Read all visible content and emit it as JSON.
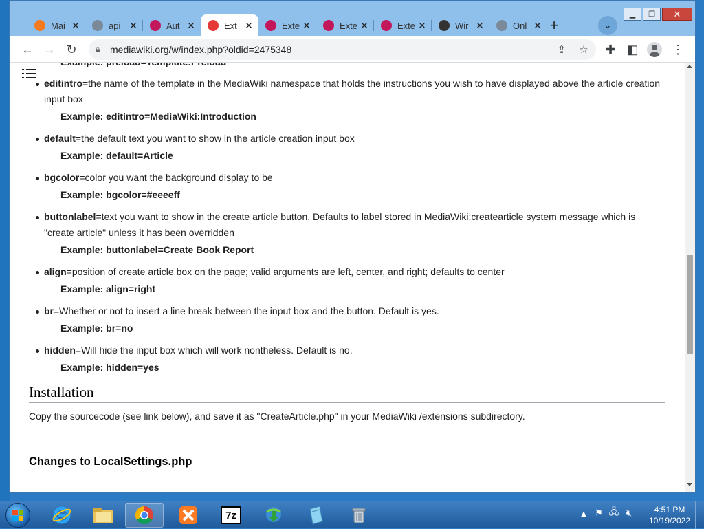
{
  "window": {
    "tabs": [
      {
        "label": "Mai",
        "icon": "xampp-icon",
        "color": "#f47a20"
      },
      {
        "label": "api",
        "icon": "globe-icon",
        "color": "#7a8a99"
      },
      {
        "label": "Aut",
        "icon": "mediawiki-icon",
        "color": "#c2185b"
      },
      {
        "label": "Ext",
        "icon": "mediawiki-icon",
        "color": "#e53935",
        "active": true
      },
      {
        "label": "Exte",
        "icon": "mediawiki-icon",
        "color": "#c2185b"
      },
      {
        "label": "Exte",
        "icon": "mediawiki-icon",
        "color": "#c2185b"
      },
      {
        "label": "Exte",
        "icon": "mediawiki-icon",
        "color": "#c2185b"
      },
      {
        "label": "Wir",
        "icon": "museum-icon",
        "color": "#333333"
      },
      {
        "label": "Onl",
        "icon": "globe-icon",
        "color": "#7a8a99"
      }
    ],
    "close_glyph": "✕",
    "new_tab_glyph": "+",
    "tab_menu_glyph": "⌄"
  },
  "toolbar": {
    "url": "mediawiki.org/w/index.php?oldid=2475348"
  },
  "page": {
    "params": [
      {
        "name": "",
        "desc": "",
        "example": "Example: preload=Template:Preload"
      },
      {
        "name": "editintro",
        "desc": "=the name of the template in the MediaWiki namespace that holds the instructions you wish to have displayed above the article creation input box",
        "example": "Example: editintro=MediaWiki:Introduction"
      },
      {
        "name": "default",
        "desc": "=the default text you want to show in the article creation input box",
        "example": "Example: default=Article"
      },
      {
        "name": "bgcolor",
        "desc": "=color you want the background display to be",
        "example": "Example: bgcolor=#eeeeff"
      },
      {
        "name": "buttonlabel",
        "desc": "=text you want to show in the create article button. Defaults to label stored in MediaWiki:createarticle system message which is \"create article\" unless it has been overridden",
        "example": "Example: buttonlabel=Create Book Report"
      },
      {
        "name": "align",
        "desc": "=position of create article box on the page; valid arguments are left, center, and right; defaults to center",
        "example": "Example: align=right"
      },
      {
        "name": "br",
        "desc": "=Whether or not to insert a line break between the input box and the button. Default is yes.",
        "example": "Example: br=no"
      },
      {
        "name": "hidden",
        "desc": "=Will hide the input box which will work nontheless. Default is no.",
        "example": "Example: hidden=yes"
      }
    ],
    "installation_heading": "Installation",
    "installation_text": "Copy the sourcecode (see link below), and save it as \"CreateArticle.php\" in your MediaWiki /extensions subdirectory.",
    "changes_heading": "Changes to LocalSettings.php"
  },
  "taskbar": {
    "apps": [
      "internet-explorer-icon",
      "file-explorer-icon",
      "chrome-icon",
      "xampp-icon",
      "7zip-icon",
      "download-manager-icon",
      "notepad-icon",
      "recycle-icon"
    ],
    "seven_zip_label": "7z",
    "time": "4:51 PM",
    "date": "10/19/2022"
  }
}
